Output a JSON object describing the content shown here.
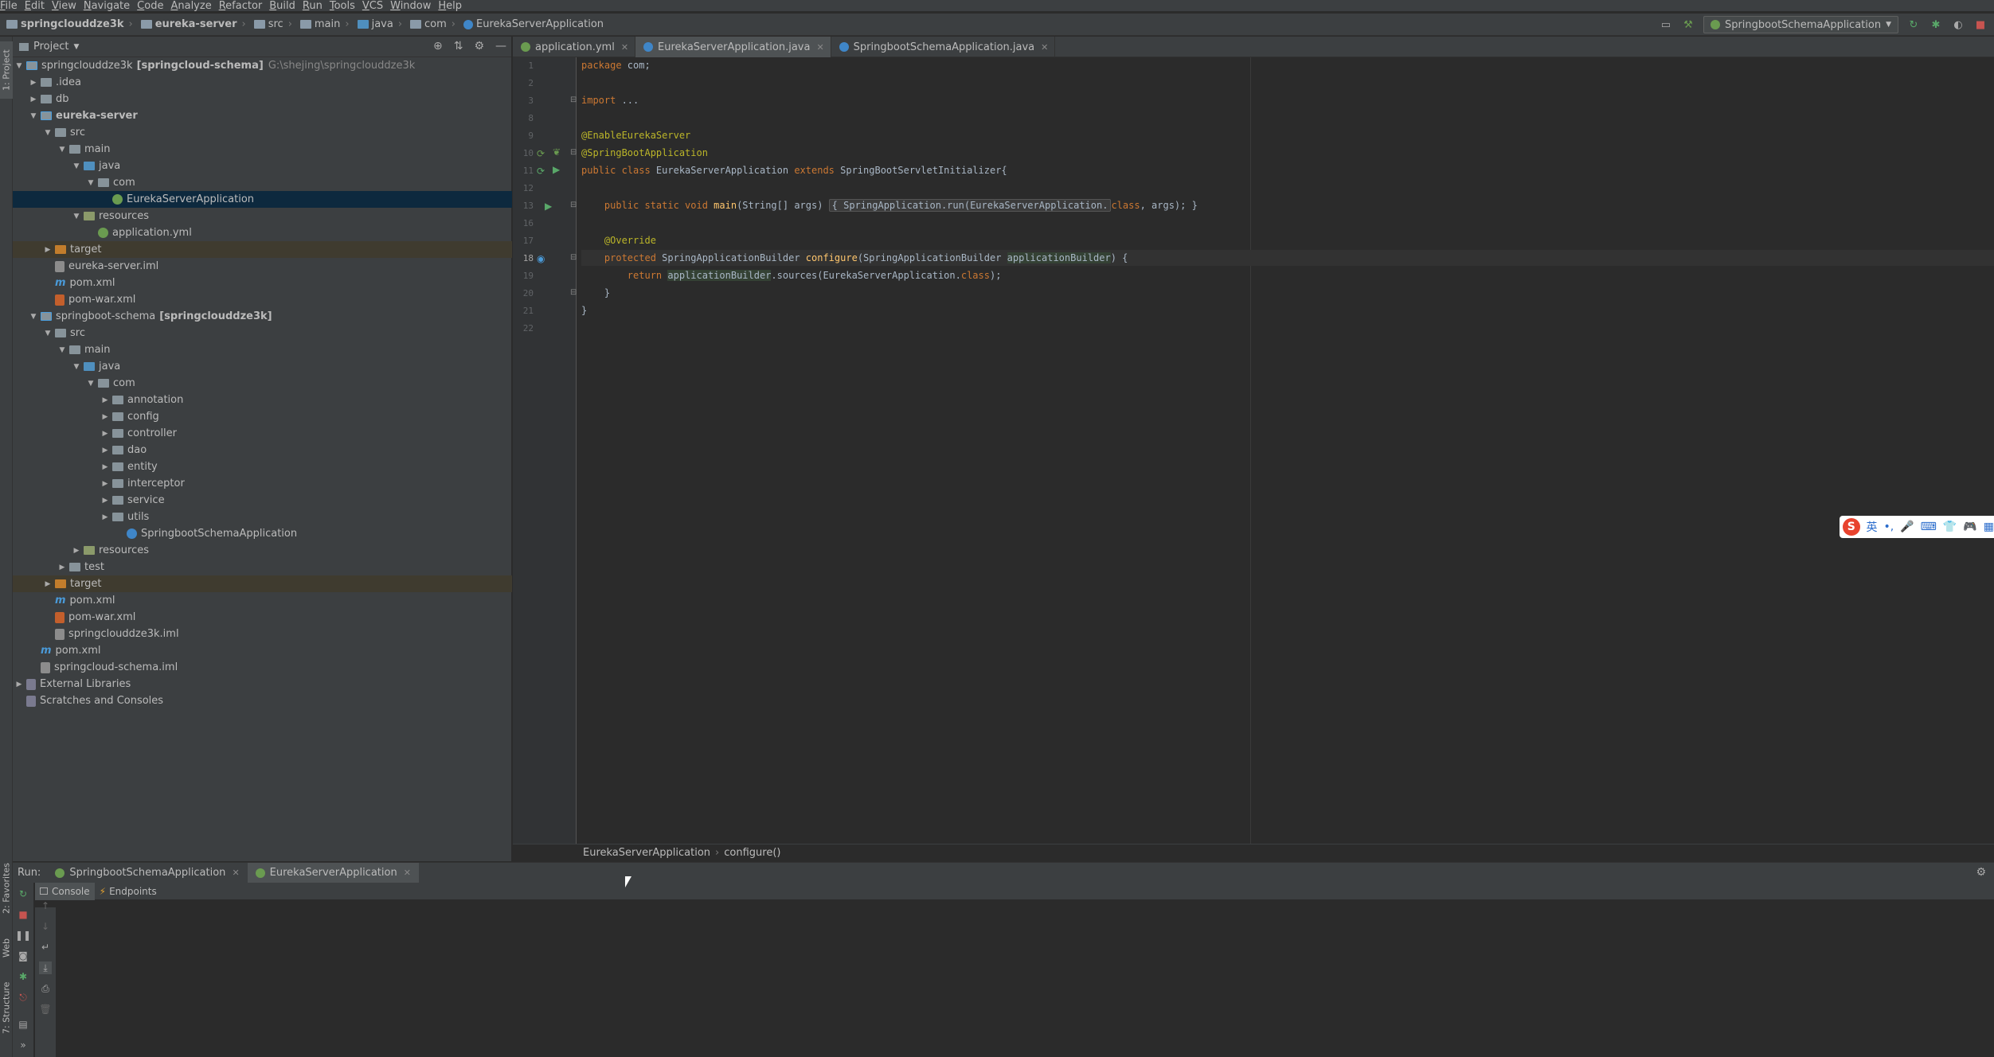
{
  "menu": [
    "File",
    "Edit",
    "View",
    "Navigate",
    "Code",
    "Analyze",
    "Refactor",
    "Build",
    "Run",
    "Tools",
    "VCS",
    "Window",
    "Help"
  ],
  "breadcrumb": [
    "springclouddze3k",
    "eureka-server",
    "src",
    "main",
    "java",
    "com",
    "EurekaServerApplication"
  ],
  "run_config": "SpringbootSchemaApplication",
  "project_panel": {
    "title": "Project",
    "tree": [
      {
        "label": "springclouddze3k",
        "extra": "[springcloud-schema]",
        "path": "G:\\shejing\\springclouddze3k"
      },
      {
        "label": ".idea"
      },
      {
        "label": "db"
      },
      {
        "label": "eureka-server"
      },
      {
        "label": "src"
      },
      {
        "label": "main"
      },
      {
        "label": "java"
      },
      {
        "label": "com"
      },
      {
        "label": "EurekaServerApplication"
      },
      {
        "label": "resources"
      },
      {
        "label": "application.yml"
      },
      {
        "label": "target"
      },
      {
        "label": "eureka-server.iml"
      },
      {
        "label": "pom.xml"
      },
      {
        "label": "pom-war.xml"
      },
      {
        "label": "springboot-schema",
        "extra": "[springclouddze3k]"
      },
      {
        "label": "src"
      },
      {
        "label": "main"
      },
      {
        "label": "java"
      },
      {
        "label": "com"
      },
      {
        "label": "annotation"
      },
      {
        "label": "config"
      },
      {
        "label": "controller"
      },
      {
        "label": "dao"
      },
      {
        "label": "entity"
      },
      {
        "label": "interceptor"
      },
      {
        "label": "service"
      },
      {
        "label": "utils"
      },
      {
        "label": "SpringbootSchemaApplication"
      },
      {
        "label": "resources"
      },
      {
        "label": "test"
      },
      {
        "label": "target"
      },
      {
        "label": "pom.xml"
      },
      {
        "label": "pom-war.xml"
      },
      {
        "label": "springclouddze3k.iml"
      },
      {
        "label": "pom.xml"
      },
      {
        "label": "springcloud-schema.iml"
      },
      {
        "label": "External Libraries"
      },
      {
        "label": "Scratches and Consoles"
      }
    ]
  },
  "editor_tabs": [
    "application.yml",
    "EurekaServerApplication.java",
    "SpringbootSchemaApplication.java"
  ],
  "line_numbers": [
    "1",
    "2",
    "3",
    "8",
    "9",
    "10",
    "11",
    "12",
    "13",
    "16",
    "17",
    "18",
    "19",
    "20",
    "21",
    "22"
  ],
  "code": {
    "l1_kw": "package",
    "l1_rest": " com;",
    "l3_kw": "import",
    "l3_rest": " ...",
    "l9": "@EnableEurekaServer",
    "l10": "@SpringBootApplication",
    "l11_a": "public class",
    "l11_b": " EurekaServerApplication ",
    "l11_c": "extends",
    "l11_d": " SpringBootServletInitializer{",
    "l13_a": "    public static void ",
    "l13_b": "main",
    "l13_c": "(String[] args) ",
    "l13_d": "{ SpringApplication.run(EurekaServerApplication.",
    "l13_e": "class",
    "l13_f": ", args); }",
    "l17": "    @Override",
    "l18_a": "    protected ",
    "l18_b": "SpringApplicationBuilder ",
    "l18_c": "configure",
    "l18_d": "(SpringApplicationBuilder ",
    "l18_e": "applicationBuilder",
    "l18_f": ") {",
    "l19_a": "        return ",
    "l19_b": "applicationBuilder",
    "l19_c": ".sources(EurekaServerApplication.",
    "l19_d": "class",
    "l19_e": ");",
    "l20": "    }",
    "l21": "}"
  },
  "editor_breadcrumb": [
    "EurekaServerApplication",
    "configure()"
  ],
  "run_panel": {
    "label": "Run:",
    "tabs": [
      "SpringbootSchemaApplication",
      "EurekaServerApplication"
    ],
    "subtabs": [
      "Console",
      "Endpoints"
    ]
  },
  "side_tabs": [
    "1: Project",
    "2: Favorites",
    "Web",
    "7: Structure"
  ],
  "ime": {
    "logo": "S",
    "lang": "英"
  }
}
